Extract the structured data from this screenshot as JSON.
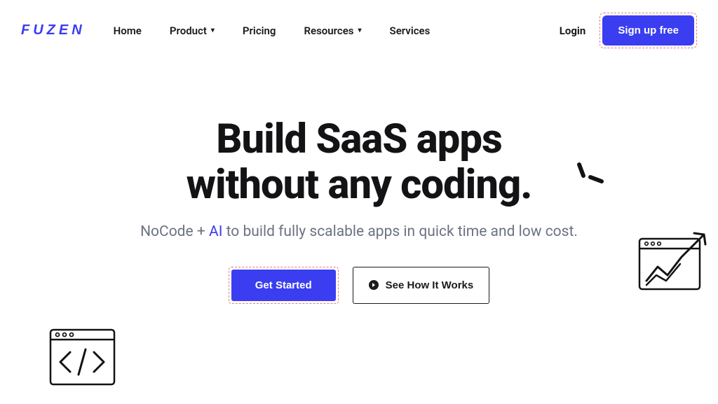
{
  "brand": "FUZEN",
  "nav": {
    "home": "Home",
    "product": "Product",
    "pricing": "Pricing",
    "resources": "Resources",
    "services": "Services",
    "login": "Login",
    "signup": "Sign up free"
  },
  "hero": {
    "headline_line1": "Build SaaS apps",
    "headline_line2": "without any coding.",
    "sub_pre": "NoCode + ",
    "sub_accent": "AI",
    "sub_post": " to build fully scalable apps in quick time and low cost.",
    "cta_primary": "Get Started",
    "cta_secondary": "See How It Works"
  }
}
